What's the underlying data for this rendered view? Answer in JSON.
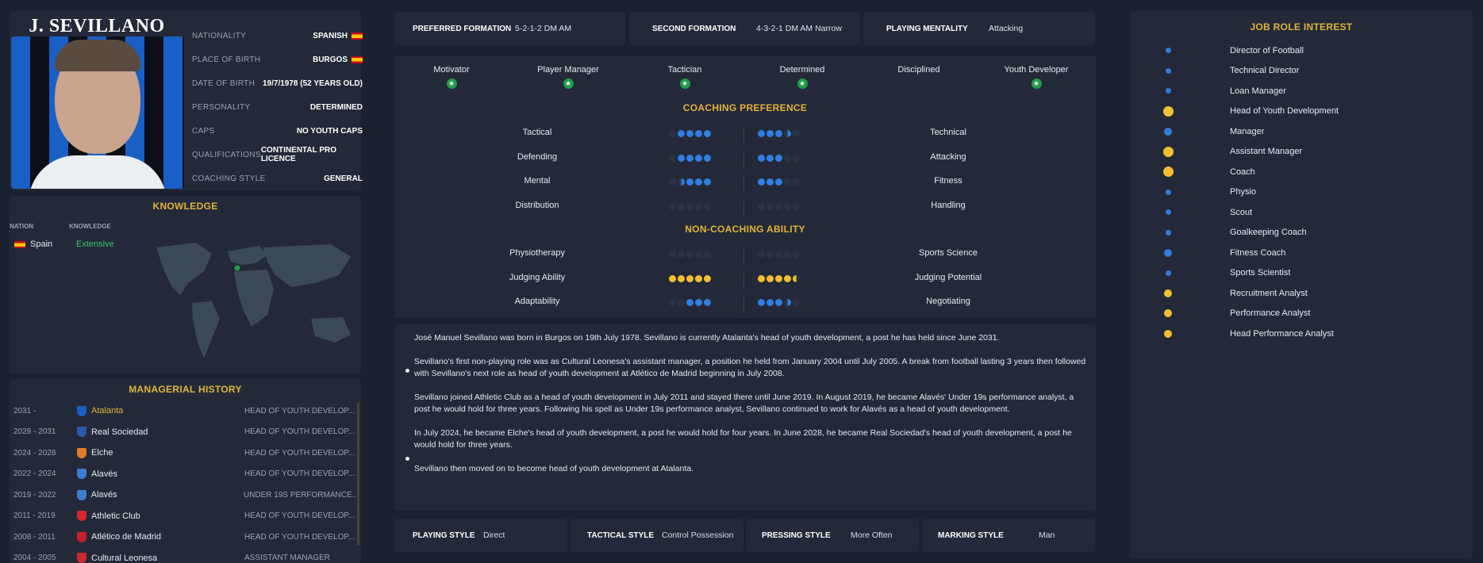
{
  "profile": {
    "name": "J. SEVILLANO",
    "rows": [
      {
        "label": "NATIONALITY",
        "value": "SPANISH",
        "flag": true
      },
      {
        "label": "PLACE OF BIRTH",
        "value": "BURGOS",
        "flag": true
      },
      {
        "label": "DATE OF BIRTH",
        "value": "19/7/1978 (52 YEARS OLD)",
        "flag": false
      },
      {
        "label": "PERSONALITY",
        "value": "DETERMINED",
        "flag": false
      },
      {
        "label": "CAPS",
        "value": "NO YOUTH CAPS",
        "flag": false
      },
      {
        "label": "QUALIFICATIONS",
        "value": "CONTINENTAL PRO LICENCE",
        "flag": false
      },
      {
        "label": "COACHING STYLE",
        "value": "GENERAL",
        "flag": false
      }
    ]
  },
  "knowledge": {
    "title": "KNOWLEDGE",
    "col_nation": "NATION",
    "col_knowledge": "KNOWLEDGE",
    "nation": "Spain",
    "level": "Extensive"
  },
  "history": {
    "title": "MANAGERIAL HISTORY",
    "rows": [
      {
        "years": "2031 -",
        "club": "Atalanta",
        "role": "HEAD OF YOUTH DEVELOP...",
        "current": true,
        "color": "#1a5fc6"
      },
      {
        "years": "2028 - 2031",
        "club": "Real Sociedad",
        "role": "HEAD OF YOUTH DEVELOP...",
        "current": false,
        "color": "#2b57b0"
      },
      {
        "years": "2024 - 2028",
        "club": "Elche",
        "role": "HEAD OF YOUTH DEVELOP...",
        "current": false,
        "color": "#e07b2a"
      },
      {
        "years": "2022 - 2024",
        "club": "Alavés",
        "role": "HEAD OF YOUTH DEVELOP...",
        "current": false,
        "color": "#3c7ed6"
      },
      {
        "years": "2019 - 2022",
        "club": "Alavés",
        "role": "UNDER 19S PERFORMANCE...",
        "current": false,
        "color": "#3c7ed6"
      },
      {
        "years": "2011 - 2019",
        "club": "Athletic Club",
        "role": "HEAD OF YOUTH DEVELOP...",
        "current": false,
        "color": "#d8262e"
      },
      {
        "years": "2008 - 2011",
        "club": "Atlético de Madrid",
        "role": "HEAD OF YOUTH DEVELOP...",
        "current": false,
        "color": "#c8202a"
      },
      {
        "years": "2004 - 2005",
        "club": "Cultural Leonesa",
        "role": "ASSISTANT MANAGER",
        "current": false,
        "color": "#c92a2a"
      }
    ]
  },
  "formations": [
    {
      "label": "PREFERRED FORMATION",
      "value": "5-2-1-2 DM AM"
    },
    {
      "label": "SECOND FORMATION",
      "value": "4-3-2-1 DM AM Narrow"
    },
    {
      "label": "PLAYING MENTALITY",
      "value": "Attacking"
    }
  ],
  "traits": [
    {
      "name": "Motivator",
      "star": true
    },
    {
      "name": "Player Manager",
      "star": true
    },
    {
      "name": "Tactician",
      "star": true
    },
    {
      "name": "Determined",
      "star": true
    },
    {
      "name": "Disciplined",
      "star": false
    },
    {
      "name": "Youth Developer",
      "star": true
    }
  ],
  "coaching_preference": {
    "title": "COACHING PREFERENCE",
    "rows": [
      {
        "left": "Tactical",
        "left_level": 4,
        "right": "Technical",
        "right_level": 3.5
      },
      {
        "left": "Defending",
        "left_level": 4,
        "right": "Attacking",
        "right_level": 3
      },
      {
        "left": "Mental",
        "left_level": 3.5,
        "right": "Fitness",
        "right_level": 3
      },
      {
        "left": "Distribution",
        "left_level": 0,
        "right": "Handling",
        "right_level": 0
      }
    ]
  },
  "non_coaching": {
    "title": "NON-COACHING ABILITY",
    "rows": [
      {
        "left": "Physiotherapy",
        "left_level": 0,
        "left_color": "b",
        "right": "Sports Science",
        "right_level": 0,
        "right_color": "b"
      },
      {
        "left": "Judging Ability",
        "left_level": 5,
        "left_color": "y",
        "right": "Judging Potential",
        "right_level": 4.5,
        "right_color": "y"
      },
      {
        "left": "Adaptability",
        "left_level": 3,
        "left_color": "b",
        "right": "Negotiating",
        "right_level": 3.5,
        "right_color": "b"
      }
    ]
  },
  "bio": {
    "paragraphs": [
      "José Manuel Sevillano was born in Burgos on 19th July 1978. Sevillano is currently Atalanta's head of youth development, a post he has held since June 2031.",
      "Sevillano's first non-playing role was as Cultural Leonesa's assistant manager, a position he held from January 2004 until July 2005. A break from football lasting 3 years then followed with Sevillano's next role as head of youth development at Atlético de Madrid beginning in July 2008.",
      "Sevillano joined Athletic Club as a head of youth development in July 2011 and stayed there until June 2019. In August 2019, he became Alavés' Under 19s performance analyst, a post he would hold for three years. Following his spell as Under 19s performance analyst, Sevillano continued to work for Alavés as a head of youth development.",
      "In July 2024, he became Elche's head of youth development, a post he would hold for four years. In June 2028, he became Real Sociedad's head of youth development, a post he would hold for three years.",
      "Sevillano then moved on to become head of youth development at Atalanta."
    ]
  },
  "styles": [
    {
      "label": "PLAYING STYLE",
      "value": "Direct"
    },
    {
      "label": "TACTICAL STYLE",
      "value": "Control Possession"
    },
    {
      "label": "PRESSING STYLE",
      "value": "More Often"
    },
    {
      "label": "MARKING STYLE",
      "value": "Man"
    }
  ],
  "job_roles": {
    "title": "JOB ROLE INTEREST",
    "rows": [
      {
        "role": "Director of Football",
        "interest": 2,
        "color": "#2f7ee0"
      },
      {
        "role": "Technical Director",
        "interest": 2,
        "color": "#2f7ee0"
      },
      {
        "role": "Loan Manager",
        "interest": 2,
        "color": "#2f7ee0"
      },
      {
        "role": "Head of Youth Development",
        "interest": 4,
        "color": "#f4bf2e"
      },
      {
        "role": "Manager",
        "interest": 3,
        "color": "#2f7ee0"
      },
      {
        "role": "Assistant Manager",
        "interest": 4,
        "color": "#f4bf2e"
      },
      {
        "role": "Coach",
        "interest": 4,
        "color": "#f4bf2e"
      },
      {
        "role": "Physio",
        "interest": 2,
        "color": "#2f7ee0"
      },
      {
        "role": "Scout",
        "interest": 2,
        "color": "#2f7ee0"
      },
      {
        "role": "Goalkeeping Coach",
        "interest": 2,
        "color": "#2f7ee0"
      },
      {
        "role": "Fitness Coach",
        "interest": 3,
        "color": "#2f7ee0"
      },
      {
        "role": "Sports Scientist",
        "interest": 2,
        "color": "#2f7ee0"
      },
      {
        "role": "Recruitment Analyst",
        "interest": 3,
        "color": "#f4bf2e"
      },
      {
        "role": "Performance Analyst",
        "interest": 3,
        "color": "#f4bf2e"
      },
      {
        "role": "Head Performance Analyst",
        "interest": 3,
        "color": "#f4bf2e"
      }
    ]
  },
  "colors": {
    "accent": "#e3b43a",
    "blue": "#2f7ee0",
    "yellow": "#f4bf2e",
    "green": "#1f9d4a",
    "panel": "#232938",
    "background": "#1c2130"
  }
}
